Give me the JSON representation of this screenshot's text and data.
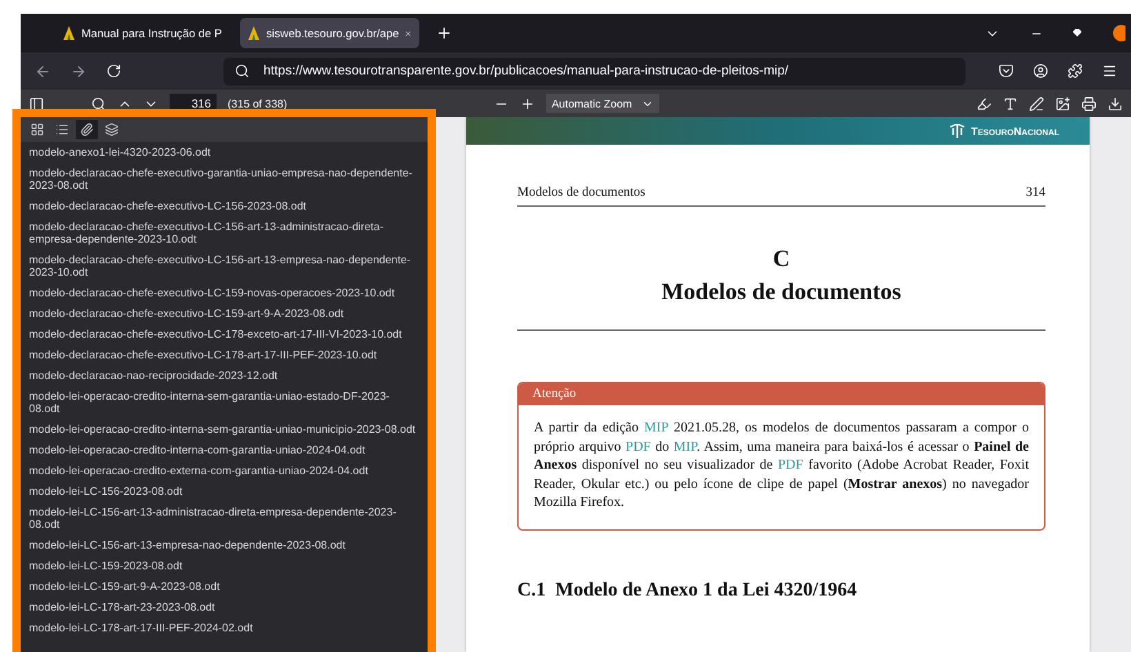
{
  "tabs": [
    {
      "title": "Manual para Instrução de P",
      "selected": false
    },
    {
      "title": "sisweb.tesouro.gov.br/ape",
      "selected": true
    }
  ],
  "address_bar": {
    "url": "https://www.tesourotransparente.gov.br/publicacoes/manual-para-instrucao-de-pleitos-mip/"
  },
  "pdf_toolbar": {
    "page_number": "316",
    "page_count": "(315 of 338)",
    "zoom": "Automatic Zoom"
  },
  "sidebar": {
    "views": [
      {
        "kind": "thumbnails",
        "selected": false
      },
      {
        "kind": "outline",
        "selected": false
      },
      {
        "kind": "attachments",
        "selected": true
      },
      {
        "kind": "layers",
        "selected": false
      }
    ],
    "attachments": [
      "modelo-anexo1-lei-4320-2023-06.odt",
      "modelo-declaracao-chefe-executivo-garantia-uniao-empresa-nao-dependente-2023-08.odt",
      "modelo-declaracao-chefe-executivo-LC-156-2023-08.odt",
      "modelo-declaracao-chefe-executivo-LC-156-art-13-administracao-direta-empresa-dependente-2023-10.odt",
      "modelo-declaracao-chefe-executivo-LC-156-art-13-empresa-nao-dependente-2023-10.odt",
      "modelo-declaracao-chefe-executivo-LC-159-novas-operacoes-2023-10.odt",
      "modelo-declaracao-chefe-executivo-LC-159-art-9-A-2023-08.odt",
      "modelo-declaracao-chefe-executivo-LC-178-exceto-art-17-III-VI-2023-10.odt",
      "modelo-declaracao-chefe-executivo-LC-178-art-17-III-PEF-2023-10.odt",
      "modelo-declaracao-nao-reciprocidade-2023-12.odt",
      "modelo-lei-operacao-credito-interna-sem-garantia-uniao-estado-DF-2023-08.odt",
      "modelo-lei-operacao-credito-interna-sem-garantia-uniao-municipio-2023-08.odt",
      "modelo-lei-operacao-credito-interna-com-garantia-uniao-2024-04.odt",
      "modelo-lei-operacao-credito-externa-com-garantia-uniao-2024-04.odt",
      "modelo-lei-LC-156-2023-08.odt",
      "modelo-lei-LC-156-art-13-administracao-direta-empresa-dependente-2023-08.odt",
      "modelo-lei-LC-156-art-13-empresa-nao-dependente-2023-08.odt",
      "modelo-lei-LC-159-2023-08.odt",
      "modelo-lei-LC-159-art-9-A-2023-08.odt",
      "modelo-lei-LC-178-art-23-2023-08.odt",
      "modelo-lei-LC-178-art-17-III-PEF-2024-02.odt"
    ]
  },
  "document": {
    "logo": "TesouroNacional",
    "running_header": "Modelos de documentos",
    "page_number": "314",
    "chapter_letter": "C",
    "chapter_title": "Modelos de documentos",
    "notice": {
      "title": "Atenção",
      "segments": [
        {
          "kind": "text",
          "text": "A partir da edição "
        },
        {
          "kind": "link",
          "text": "MIP"
        },
        {
          "kind": "text",
          "text": " 2021.05.28, os modelos de documentos passaram a compor o próprio arquivo "
        },
        {
          "kind": "link",
          "text": "PDF"
        },
        {
          "kind": "text",
          "text": " do "
        },
        {
          "kind": "link",
          "text": "MIP"
        },
        {
          "kind": "text",
          "text": ". Assim, uma maneira para baixá-los é acessar o "
        },
        {
          "kind": "bold",
          "text": "Painel de Anexos"
        },
        {
          "kind": "text",
          "text": " disponível no seu visualizador de "
        },
        {
          "kind": "link",
          "text": "PDF"
        },
        {
          "kind": "text",
          "text": " favorito (Adobe Acrobat Reader, Foxit Reader, Okular etc.) ou pelo ícone de clipe de papel ("
        },
        {
          "kind": "bold",
          "text": "Mostrar anexos"
        },
        {
          "kind": "text",
          "text": ") no navegador Mozilla Firefox."
        }
      ]
    },
    "section_heading": "C.1  Modelo de Anexo 1 da Lei 4320/1964"
  }
}
